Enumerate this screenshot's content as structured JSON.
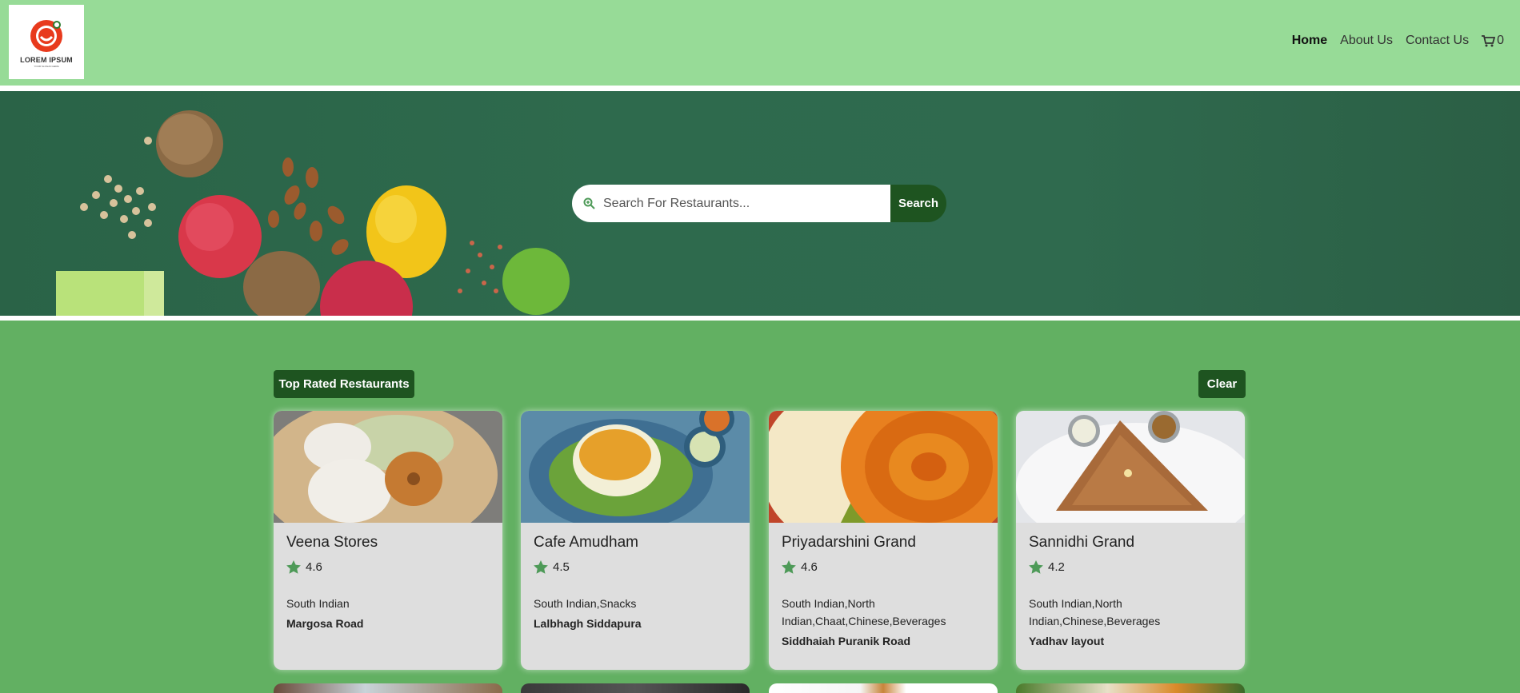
{
  "header": {
    "logo": {
      "brand": "LOREM IPSUM",
      "tagline": "YOUR SLOGAN HERE",
      "icon": "smiley-food-icon"
    },
    "nav": [
      {
        "label": "Home",
        "active": true
      },
      {
        "label": "About Us",
        "active": false
      },
      {
        "label": "Contact Us",
        "active": false
      }
    ],
    "cart": {
      "icon": "cart-icon",
      "count": "0"
    }
  },
  "search": {
    "placeholder": "Search For Restaurants...",
    "button_label": "Search",
    "icon": "search-icon"
  },
  "section": {
    "title_button": "Top Rated Restaurants",
    "clear_button": "Clear"
  },
  "restaurants": [
    {
      "name": "Veena Stores",
      "rating": "4.6",
      "cuisine": "South Indian",
      "area": "Margosa Road"
    },
    {
      "name": "Cafe Amudham",
      "rating": "4.5",
      "cuisine": "South Indian,Snacks",
      "area": "Lalbhagh Siddapura"
    },
    {
      "name": "Priyadarshini Grand",
      "rating": "4.6",
      "cuisine": "South Indian,North Indian,Chaat,Chinese,Beverages",
      "area": "Siddhaiah Puranik Road"
    },
    {
      "name": "Sannidhi Grand",
      "rating": "4.2",
      "cuisine": "South Indian,North Indian,Chinese,Beverages",
      "area": "Yadhav layout"
    }
  ],
  "colors": {
    "header_bg": "#97db97",
    "page_bg": "#62b062",
    "accent_dark": "#1e5420",
    "card_bg": "#dedede",
    "star": "#4e9a58"
  }
}
